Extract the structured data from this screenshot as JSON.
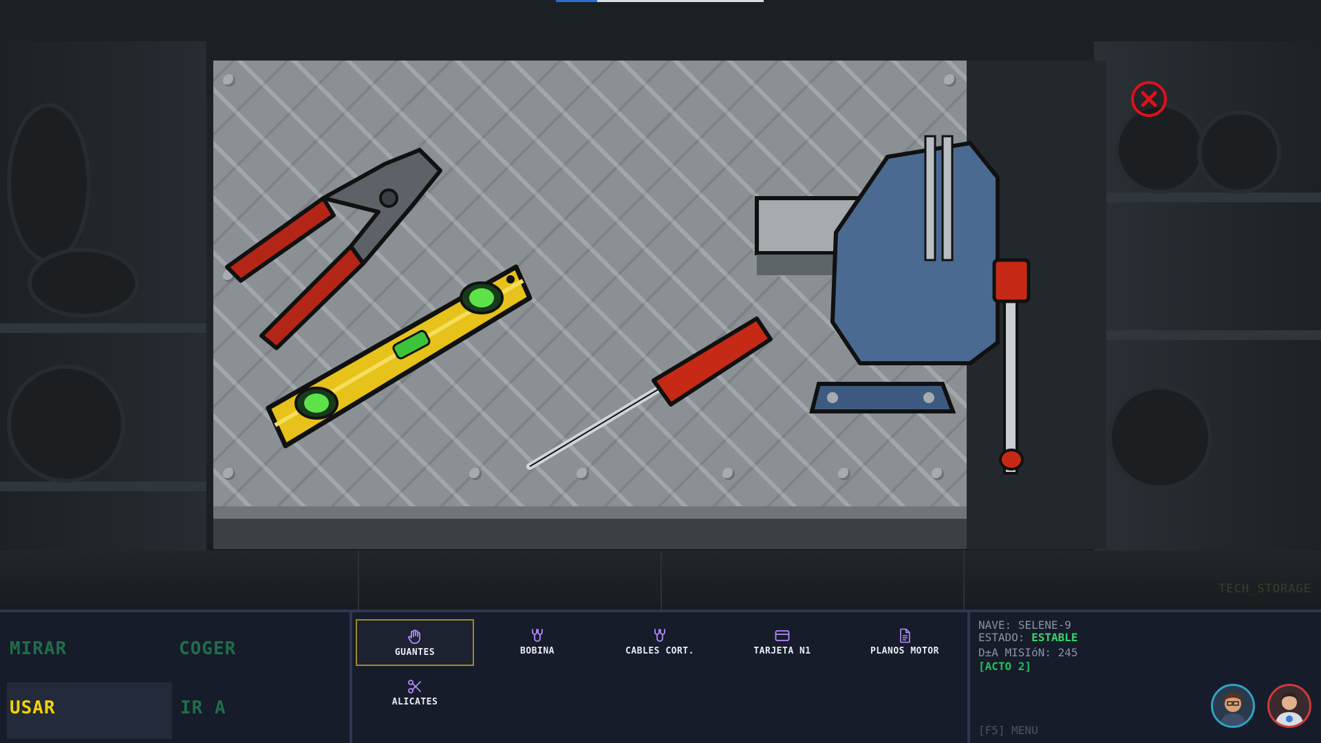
{
  "scene": {
    "corner_label": "TECH_STORAGE"
  },
  "closeup": {
    "objects": [
      "pliers-icon",
      "spirit-level-icon",
      "screwdriver-icon",
      "bench-vise-icon"
    ],
    "close_icon": "close-icon"
  },
  "verbs": {
    "look": "MIRAR",
    "take": "COGER",
    "use": "USAR",
    "goto": "IR A",
    "active": "USAR"
  },
  "inventory": {
    "items": [
      {
        "label": "GUANTES",
        "icon": "glove-icon",
        "selected": true
      },
      {
        "label": "BOBINA",
        "icon": "cable-icon",
        "selected": false
      },
      {
        "label": "CABLES CORT.",
        "icon": "cut-cable-icon",
        "selected": false
      },
      {
        "label": "TARJETA N1",
        "icon": "card-icon",
        "selected": false
      },
      {
        "label": "PLANOS MOTOR",
        "icon": "document-icon",
        "selected": false
      },
      {
        "label": "ALICATES",
        "icon": "scissors-icon",
        "selected": false
      }
    ]
  },
  "status": {
    "ship_label": "NAVE:",
    "ship_value": "SELENE-9",
    "state_label": "ESTADO:",
    "state_value": "ESTABLE",
    "day_label": "D±A MISIóN:",
    "day_value": "245",
    "act": "[ACTO 2]",
    "menu_hint": "[F5] MENU"
  },
  "colors": {
    "accent_yellow": "#f2d400",
    "verb_green": "#1f6e4a",
    "status_green": "#37d66a",
    "close_red": "#e0101c",
    "icon_purple": "#b58cff"
  }
}
